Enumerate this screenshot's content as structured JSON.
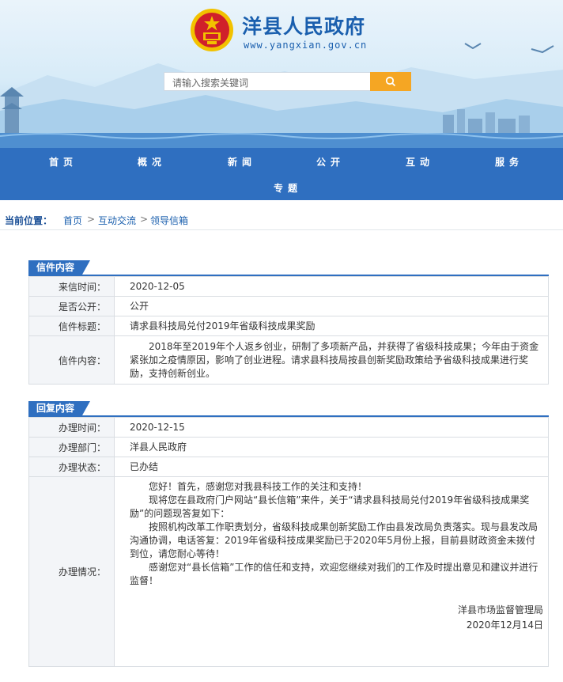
{
  "header": {
    "site_title": "洋县人民政府",
    "site_url": "www.yangxian.gov.cn",
    "search_placeholder": "请输入搜索关键词"
  },
  "nav": {
    "items": [
      "首页",
      "概况",
      "新闻",
      "公开",
      "互动",
      "服务",
      "专题"
    ]
  },
  "breadcrumb": {
    "label": "当前位置：",
    "items": [
      "首页",
      "互动交流",
      "领导信箱"
    ],
    "separator": ">"
  },
  "letter": {
    "section_title": "信件内容",
    "rows": [
      {
        "key": "来信时间：",
        "value": "2020-12-05"
      },
      {
        "key": "是否公开：",
        "value": "公开"
      },
      {
        "key": "信件标题：",
        "value": "请求县科技局兑付2019年省级科技成果奖励"
      },
      {
        "key": "信件内容：",
        "value": "2018年至2019年个人返乡创业，研制了多项新产品，并获得了省级科技成果；今年由于资金紧张加之疫情原因，影响了创业进程。请求县科技局按县创新奖励政策给予省级科技成果进行奖励，支持创新创业。"
      }
    ]
  },
  "reply": {
    "section_title": "回复内容",
    "rows": [
      {
        "key": "办理时间：",
        "value": "2020-12-15"
      },
      {
        "key": "办理部门：",
        "value": "洋县人民政府"
      },
      {
        "key": "办理状态：",
        "value": "已办结"
      }
    ],
    "detail_key": "办理情况：",
    "detail_paragraphs": [
      "您好！首先，感谢您对我县科技工作的关注和支持！",
      "现将您在县政府门户网站“县长信箱”来件，关于“请求县科技局兑付2019年省级科技成果奖励”的问题现答复如下：",
      "按照机构改革工作职责划分，省级科技成果创新奖励工作由县发改局负责落实。现与县发改局沟通协调，电话答复：2019年省级科技成果奖励已于2020年5月份上报，目前县财政资金未拨付到位，请您耐心等待！",
      "感谢您对“县长信箱”工作的信任和支持，欢迎您继续对我们的工作及时提出意见和建议并进行监督！"
    ],
    "signature": "洋县市场监督管理局",
    "date": "2020年12月14日"
  },
  "colors": {
    "nav_blue": "#2f6fc0",
    "brand_blue": "#1a5fae",
    "search_orange": "#f5a623",
    "emblem_red": "#d0202a",
    "emblem_gold": "#f2c200"
  },
  "icons": {
    "search": "search-icon",
    "emblem": "national-emblem-icon"
  }
}
